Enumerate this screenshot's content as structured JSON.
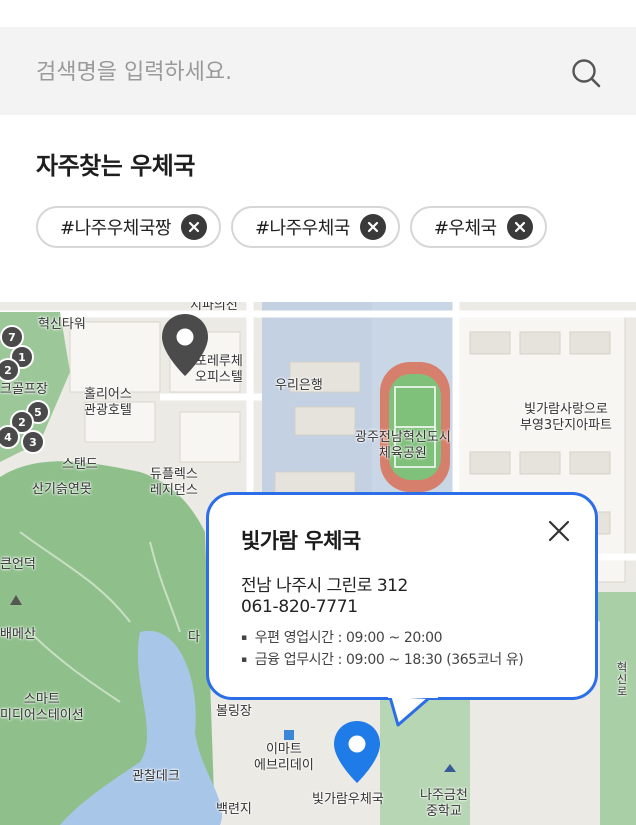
{
  "search": {
    "placeholder": "검색명을 입력하세요.",
    "icon": "search-icon"
  },
  "favorites": {
    "title": "자주찾는 우체국",
    "chips": [
      {
        "label": "#나주우체국짱",
        "remove_icon": "close-circle-icon"
      },
      {
        "label": "#나주우체국",
        "remove_icon": "close-circle-icon"
      },
      {
        "label": "#우체국",
        "remove_icon": "close-circle-icon"
      }
    ]
  },
  "map": {
    "labels": {
      "top_cut": "지파의전",
      "hyeoksin_tower": "혁신타워",
      "forerue": "포레루체\n오피스텔",
      "woori": "우리은행",
      "golf": "크골프장",
      "holiers": "홀리어스\n관광호텔",
      "stadium": "광주전남혁신도시\n체육공원",
      "bitgaram_apt": "빛가람사랑으로\n부영3단지아파트",
      "stand": "스탠드",
      "forest": "산기슭연못",
      "duplex": "듀플렉스\n레지던스",
      "eondeok": "큰언덕",
      "maesan": "배메산",
      "da": "다",
      "smart": "스마트\n미디어스테이션",
      "bowling": "볼링장",
      "emart": "이마트\n에브리데이",
      "observatory": "관찰데크",
      "baekyeonji": "백련지",
      "post_office": "빛가람우체국",
      "school": "나주금천\n중학교",
      "road": "혁신로"
    },
    "cluster_counts": [
      "7",
      "1",
      "2",
      "5",
      "2",
      "4",
      "3"
    ],
    "colors": {
      "park": "#8fc08c",
      "water": "#a8c6e8",
      "urban": "#eceae4",
      "gov": "#c3d1e3",
      "accent": "#2b6ee8"
    }
  },
  "popup": {
    "title": "빛가람 우체국",
    "address": "전남 나주시 그린로 312",
    "phone": "061-820-7771",
    "hours": [
      "우편 영업시간 : 09:00 ~ 20:00",
      "금융 업무시간 : 09:00 ~ 18:30 (365코너 유)"
    ],
    "close_icon": "close-icon"
  },
  "markers": [
    "map-pin-icon",
    "selected-location-pin-icon"
  ]
}
